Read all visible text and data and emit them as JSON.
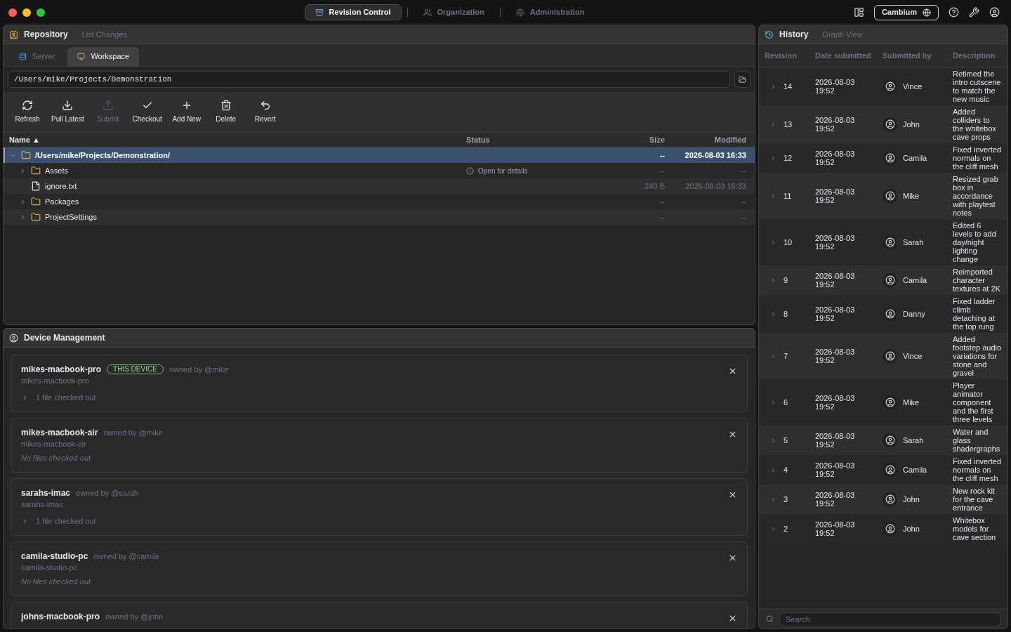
{
  "nav_tabs": [
    {
      "label": "Revision Control",
      "selected": true
    },
    {
      "label": "Organization",
      "selected": false
    },
    {
      "label": "Administration",
      "selected": false
    }
  ],
  "workspace_button": "Cambium",
  "repository": {
    "title": "Repository",
    "secondary_tab": "List Changes",
    "tabs": [
      {
        "label": "Server",
        "selected": false
      },
      {
        "label": "Workspace",
        "selected": true
      }
    ],
    "path": "/Users/mike/Projects/Demonstration",
    "toolbar": [
      {
        "label": "Refresh",
        "disabled": false
      },
      {
        "label": "Pull Latest",
        "disabled": false
      },
      {
        "label": "Submit",
        "disabled": true
      },
      {
        "label": "Checkout",
        "disabled": false
      },
      {
        "label": "Add New",
        "disabled": false
      },
      {
        "label": "Delete",
        "disabled": false
      },
      {
        "label": "Revert",
        "disabled": false
      }
    ],
    "columns": [
      "Name ▲",
      "Status",
      "Size",
      "Modified"
    ],
    "tree": [
      {
        "name": "/Users/mike/Projects/Demonstration/",
        "kind": "folder",
        "expanded": true,
        "selected": true,
        "size": "--",
        "modified": "2026-08-03 16:33",
        "children": [
          {
            "name": "Assets",
            "kind": "folder",
            "expanded": false,
            "selected": false,
            "status": "Open for details",
            "size": "--",
            "modified": "--"
          },
          {
            "name": "ignore.txt",
            "kind": "file",
            "selected": false,
            "size": "240 B",
            "modified": "2026-08-03 16:33"
          },
          {
            "name": "Packages",
            "kind": "folder",
            "expanded": false,
            "selected": false,
            "size": "--",
            "modified": "--"
          },
          {
            "name": "ProjectSettings",
            "kind": "folder",
            "expanded": false,
            "selected": false,
            "size": "--",
            "modified": "--"
          }
        ]
      }
    ]
  },
  "devices": {
    "title": "Device Management",
    "items": [
      {
        "name": "mikes-macbook-pro",
        "badge": "THIS DEVICE",
        "owner": "owned by @mike",
        "host": "mikes-macbook-pro",
        "files": "1 file checked out",
        "has_files": true
      },
      {
        "name": "mikes-macbook-air",
        "owner": "owned by @mike",
        "host": "mikes-macbook-air",
        "files": "No files checked out",
        "has_files": false
      },
      {
        "name": "sarahs-imac",
        "owner": "owned by @sarah",
        "host": "sarahs-imac",
        "files": "1 file checked out",
        "has_files": true
      },
      {
        "name": "camila-studio-pc",
        "owner": "owned by @camila",
        "host": "camila-studio-pc",
        "files": "No files checked out",
        "has_files": false
      },
      {
        "name": "johns-macbook-pro",
        "owner": "owned by @john"
      }
    ]
  },
  "history": {
    "title": "History",
    "secondary_tab": "Graph View",
    "columns": [
      "Revision",
      "Date submitted",
      "Submitted by",
      "Description"
    ],
    "rows": [
      {
        "revision": "14",
        "date": "2026-08-03 19:52",
        "user": "Vince",
        "description": "Retimed the intro cutscene to match the new music"
      },
      {
        "revision": "13",
        "date": "2026-08-03 19:52",
        "user": "John",
        "description": "Added colliders to the whitebox cave props"
      },
      {
        "revision": "12",
        "date": "2026-08-03 19:52",
        "user": "Camila",
        "description": "Fixed inverted normals on the cliff mesh"
      },
      {
        "revision": "11",
        "date": "2026-08-03 19:52",
        "user": "Mike",
        "description": "Resized grab box in accordance with playtest notes"
      },
      {
        "revision": "10",
        "date": "2026-08-03 19:52",
        "user": "Sarah",
        "description": "Edited 6 levels to add day/night lighting change"
      },
      {
        "revision": "9",
        "date": "2026-08-03 19:52",
        "user": "Camila",
        "description": "Reimported character textures at 2K"
      },
      {
        "revision": "8",
        "date": "2026-08-03 19:52",
        "user": "Danny",
        "description": "Fixed ladder climb detaching at the top rung"
      },
      {
        "revision": "7",
        "date": "2026-08-03 19:52",
        "user": "Vince",
        "description": "Added footstep audio variations for stone and gravel"
      },
      {
        "revision": "6",
        "date": "2026-08-03 19:52",
        "user": "Mike",
        "description": "Player animator component and the first three levels"
      },
      {
        "revision": "5",
        "date": "2026-08-03 19:52",
        "user": "Sarah",
        "description": "Water and glass shadergraphs"
      },
      {
        "revision": "4",
        "date": "2026-08-03 19:52",
        "user": "Camila",
        "description": "Fixed inverted normals on the cliff mesh"
      },
      {
        "revision": "3",
        "date": "2026-08-03 19:52",
        "user": "John",
        "description": "New rock kit for the cave entrance"
      },
      {
        "revision": "2",
        "date": "2026-08-03 19:52",
        "user": "John",
        "description": "Whitebox models for cave section"
      }
    ],
    "search": {
      "placeholder": "Search"
    }
  }
}
